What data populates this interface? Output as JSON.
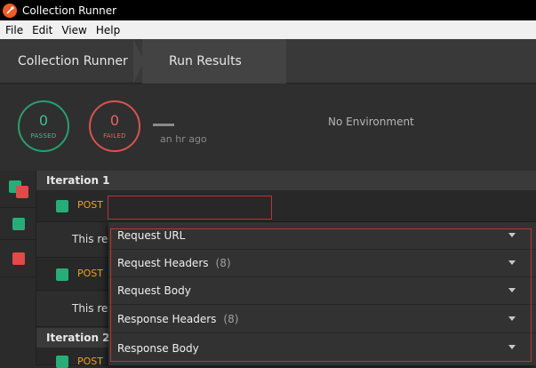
{
  "window": {
    "title": "Collection Runner",
    "app_icon": "postman-icon"
  },
  "menu": {
    "items": [
      "File",
      "Edit",
      "View",
      "Help"
    ]
  },
  "breadcrumb": {
    "first": "Collection Runner",
    "second": "Run Results"
  },
  "summary": {
    "passed_count": "0",
    "passed_label": "PASSED",
    "failed_count": "0",
    "failed_label": "FAILED",
    "time_dash": "—",
    "time_ago": "an hr ago",
    "environment": "No Environment"
  },
  "iterations": [
    {
      "label": "Iteration 1",
      "requests": [
        {
          "method": "POST",
          "status": "pass",
          "description": "This req"
        },
        {
          "method": "POST",
          "status": "pass",
          "description": "This req"
        }
      ]
    },
    {
      "label": "Iteration 2",
      "requests": [
        {
          "method": "POST",
          "status": "pass"
        }
      ]
    }
  ],
  "dropdown": {
    "items": [
      {
        "label": "Request URL",
        "count": ""
      },
      {
        "label": "Request Headers",
        "count": "(8)"
      },
      {
        "label": "Request Body",
        "count": ""
      },
      {
        "label": "Response Headers",
        "count": "(8)"
      },
      {
        "label": "Response Body",
        "count": ""
      }
    ]
  },
  "colors": {
    "pass": "#27ae78",
    "fail": "#e44848",
    "method": "#e9a321",
    "highlight": "#c2332f"
  }
}
